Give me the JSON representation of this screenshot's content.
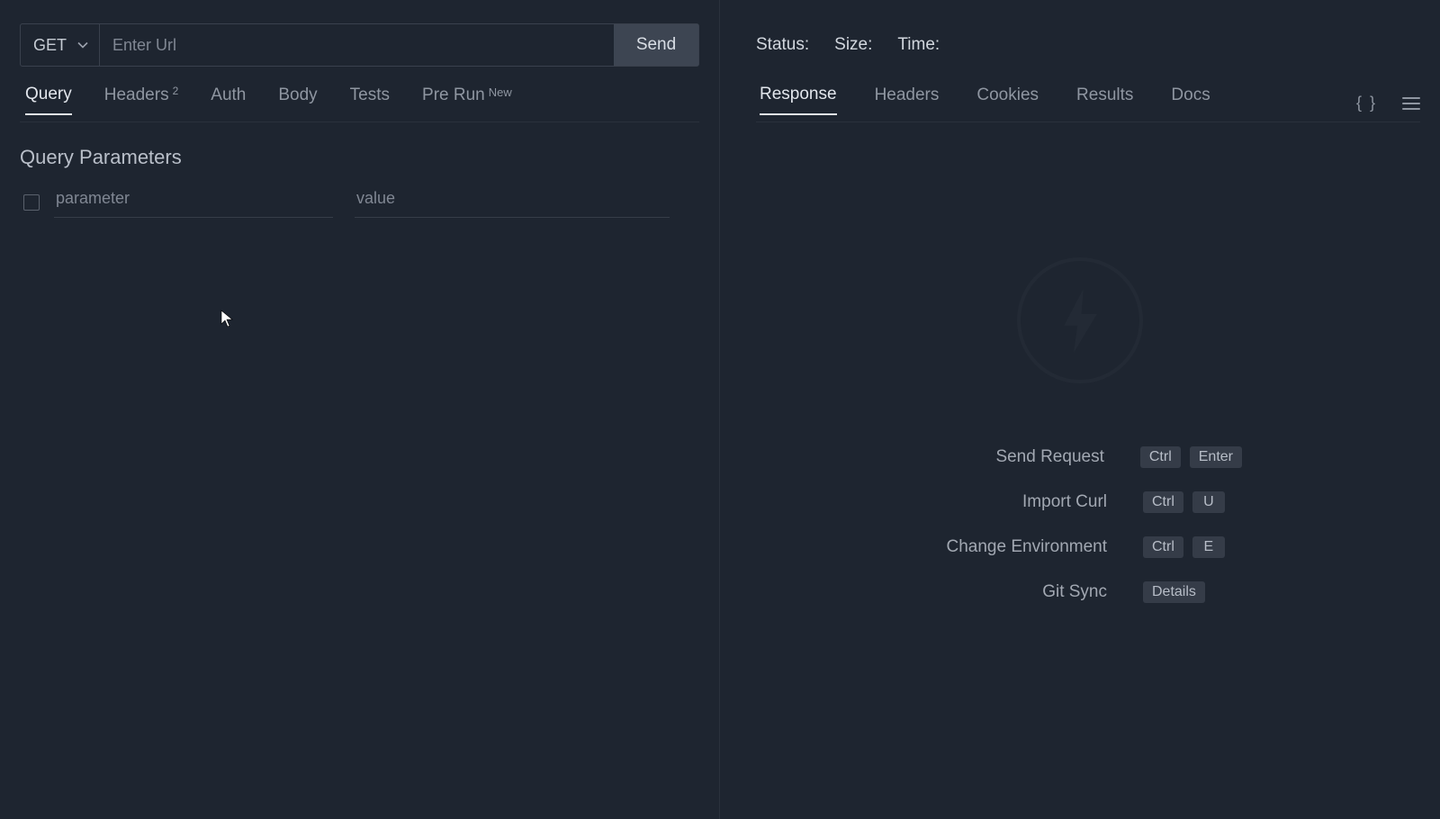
{
  "request": {
    "method": "GET",
    "url_placeholder": "Enter Url",
    "send_label": "Send",
    "tabs": {
      "query": "Query",
      "headers": "Headers",
      "headers_count": "2",
      "auth": "Auth",
      "body": "Body",
      "tests": "Tests",
      "prerun": "Pre Run",
      "prerun_badge": "New"
    },
    "section_title": "Query Parameters",
    "param_name_placeholder": "parameter",
    "param_value_placeholder": "value"
  },
  "response": {
    "status_label": "Status:",
    "size_label": "Size:",
    "time_label": "Time:",
    "tabs": {
      "response": "Response",
      "headers": "Headers",
      "cookies": "Cookies",
      "results": "Results",
      "docs": "Docs"
    },
    "braces": "{ }",
    "shortcuts": [
      {
        "label": "Send Request",
        "keys": [
          "Ctrl",
          "Enter"
        ]
      },
      {
        "label": "Import Curl",
        "keys": [
          "Ctrl",
          "U"
        ]
      },
      {
        "label": "Change Environment",
        "keys": [
          "Ctrl",
          "E"
        ]
      },
      {
        "label": "Git Sync",
        "details": "Details"
      }
    ]
  }
}
